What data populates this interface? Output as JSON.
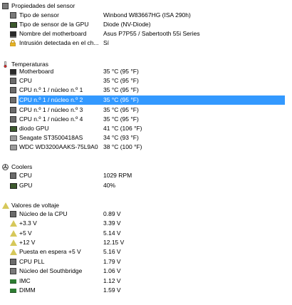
{
  "sensor_props": {
    "header": "Propiedades del sensor",
    "rows": [
      {
        "label": "Tipo de sensor",
        "value": "Winbond W83667HG  (ISA 290h)",
        "icon": "sensor-chip-icon"
      },
      {
        "label": "Tipo de sensor de la GPU",
        "value": "Diode  (NV-Diode)",
        "icon": "gpu-icon"
      },
      {
        "label": "Nombre del motherboard",
        "value": "Asus P7P55 / Sabertooth 55i Series",
        "icon": "motherboard-icon"
      },
      {
        "label": "Intrusión detectada en el ch...",
        "value": "Sí",
        "icon": "lock-icon"
      }
    ]
  },
  "temperatures": {
    "header": "Temperaturas",
    "rows": [
      {
        "label": "Motherboard",
        "value": "35 °C  (95 °F)",
        "icon": "motherboard-icon"
      },
      {
        "label": "CPU",
        "value": "35 °C  (95 °F)",
        "icon": "cpu-icon"
      },
      {
        "label": "CPU n.º 1 / núcleo n.º 1",
        "value": "35 °C  (95 °F)",
        "icon": "cpu-icon"
      },
      {
        "label": "CPU n.º 1 / núcleo n.º 2",
        "value": "35 °C  (95 °F)",
        "icon": "cpu-icon",
        "selected": true
      },
      {
        "label": "CPU n.º 1 / núcleo n.º 3",
        "value": "35 °C  (95 °F)",
        "icon": "cpu-icon"
      },
      {
        "label": "CPU n.º 1 / núcleo n.º 4",
        "value": "35 °C  (95 °F)",
        "icon": "cpu-icon"
      },
      {
        "label": "diodo GPU",
        "value": "41 °C  (106 °F)",
        "icon": "gpu-icon"
      },
      {
        "label": "Seagate ST3500418AS",
        "value": "34 °C  (93 °F)",
        "icon": "hdd-icon"
      },
      {
        "label": "WDC WD3200AAKS-75L9A0",
        "value": "38 °C  (100 °F)",
        "icon": "hdd-icon"
      }
    ]
  },
  "coolers": {
    "header": "Coolers",
    "rows": [
      {
        "label": "CPU",
        "value": "1029 RPM",
        "icon": "cpu-icon"
      },
      {
        "label": "GPU",
        "value": "40%",
        "icon": "gpu-icon"
      }
    ]
  },
  "voltages": {
    "header": "Valores de voltaje",
    "rows": [
      {
        "label": "Núcleo de la CPU",
        "value": "0.89 V",
        "icon": "cpu-icon"
      },
      {
        "label": "+3.3 V",
        "value": "3.39 V",
        "icon": "voltage-warning-icon"
      },
      {
        "label": "+5 V",
        "value": "5.14 V",
        "icon": "voltage-warning-icon"
      },
      {
        "label": "+12 V",
        "value": "12.15 V",
        "icon": "voltage-warning-icon"
      },
      {
        "label": "Puesta en espera +5 V",
        "value": "5.16 V",
        "icon": "voltage-warning-icon"
      },
      {
        "label": "CPU PLL",
        "value": "1.79 V",
        "icon": "cpu-icon"
      },
      {
        "label": "Núcleo del Southbridge",
        "value": "1.06 V",
        "icon": "chip-icon"
      },
      {
        "label": "IMC",
        "value": "1.12 V",
        "icon": "memory-icon"
      },
      {
        "label": "DIMM",
        "value": "1.59 V",
        "icon": "memory-icon"
      }
    ]
  }
}
